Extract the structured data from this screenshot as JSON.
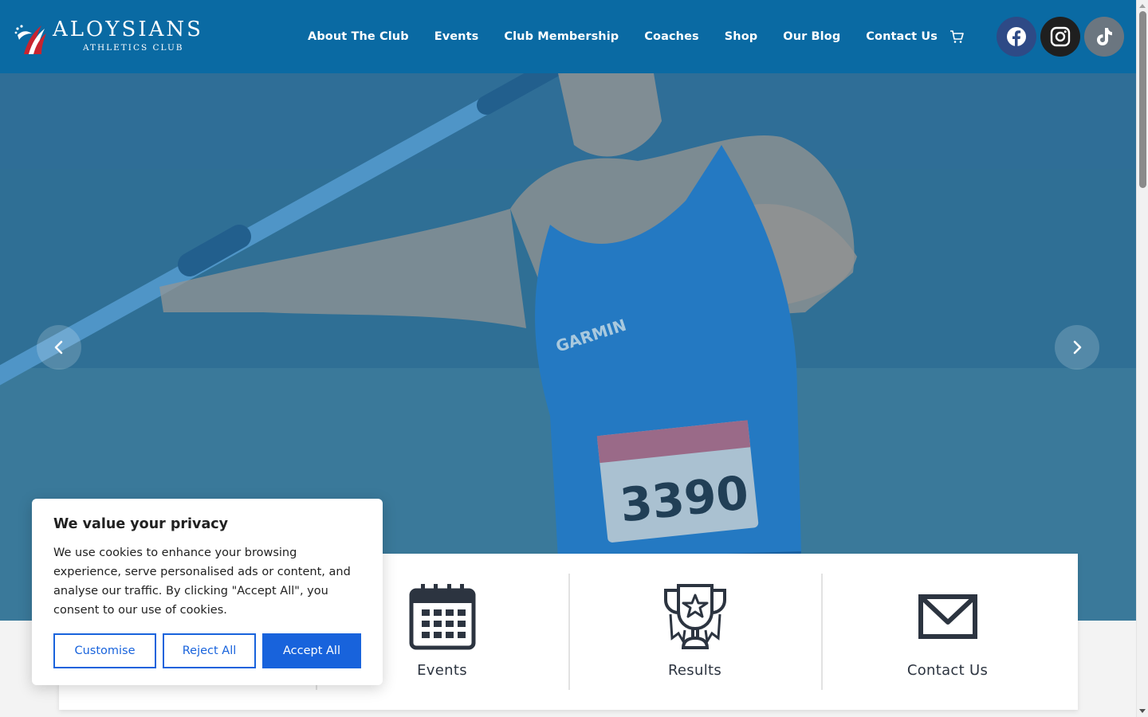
{
  "brand": {
    "title": "ALOYSIANS",
    "subtitle": "ATHLETICS CLUB",
    "logo_icon": "eagle-stripes-logo"
  },
  "nav": {
    "items": [
      {
        "label": "About The Club"
      },
      {
        "label": "Events"
      },
      {
        "label": "Club Membership"
      },
      {
        "label": "Coaches"
      },
      {
        "label": "Shop"
      },
      {
        "label": "Our Blog"
      },
      {
        "label": "Contact Us"
      }
    ],
    "cart_icon": "cart-icon"
  },
  "social": [
    {
      "name": "facebook-icon",
      "color": "#2e4a86"
    },
    {
      "name": "instagram-icon",
      "color": "#1f1f1f"
    },
    {
      "name": "tiktok-icon",
      "color": "#6b7680"
    }
  ],
  "hero": {
    "bib_number": "3390",
    "sponsor": "GARMIN",
    "overlay_color": "#0a6aa3"
  },
  "quick_links": [
    {
      "label": "Events",
      "icon": "calendar-icon"
    },
    {
      "label": "Results",
      "icon": "trophy-icon"
    },
    {
      "label": "Contact Us",
      "icon": "envelope-icon"
    }
  ],
  "cookie": {
    "title": "We value your privacy",
    "text": "We use cookies to enhance your browsing experience, serve personalised ads or content, and analyse our traffic. By clicking \"Accept All\", you consent to our use of cookies.",
    "customise": "Customise",
    "reject": "Reject All",
    "accept": "Accept All",
    "accent": "#1863dc"
  },
  "colors": {
    "header": "#0a6aa3",
    "text_dark": "#2c3440"
  }
}
